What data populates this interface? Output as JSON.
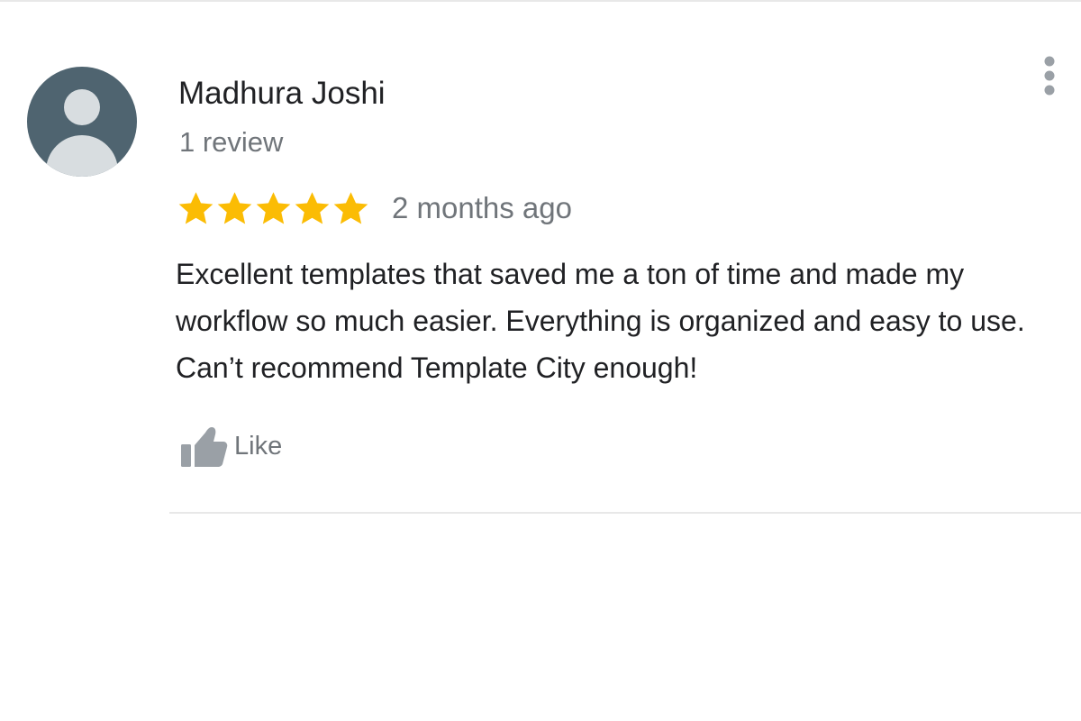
{
  "review": {
    "reviewer_name": "Madhura Joshi",
    "review_count": "1 review",
    "rating": 5,
    "rating_max": 5,
    "timestamp": "2 months ago",
    "text": "Excellent templates that saved me a ton of time and made my workflow so much easier. Everything is organized and easy to use. Can’t recommend Template City enough!",
    "like_label": "Like"
  },
  "icons": {
    "avatar": "default-user-avatar-icon",
    "star": "star-icon",
    "like": "thumbs-up-icon",
    "menu": "more-vertical-icon"
  },
  "colors": {
    "star": "#fbbc04",
    "avatar_bg": "#4f6470",
    "avatar_fg": "#d8dde0",
    "secondary_text": "#70757a",
    "primary_text": "#202124",
    "icon_gray": "#9aa0a6"
  }
}
